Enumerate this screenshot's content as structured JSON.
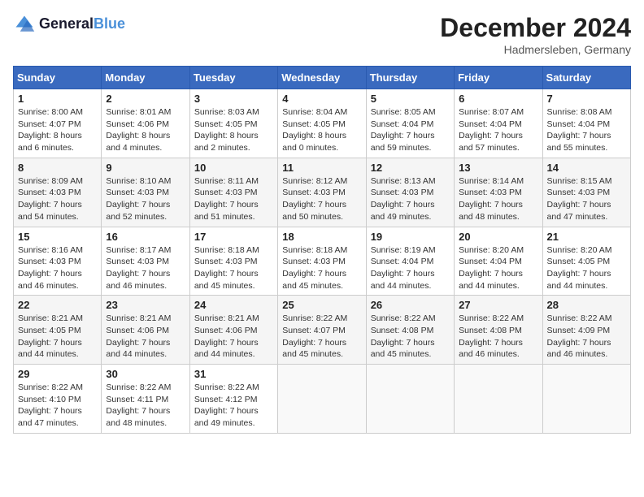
{
  "header": {
    "logo_line1": "General",
    "logo_line2": "Blue",
    "month_title": "December 2024",
    "location": "Hadmersleben, Germany"
  },
  "weekdays": [
    "Sunday",
    "Monday",
    "Tuesday",
    "Wednesday",
    "Thursday",
    "Friday",
    "Saturday"
  ],
  "weeks": [
    [
      {
        "day": "1",
        "sunrise": "8:00 AM",
        "sunset": "4:07 PM",
        "daylight": "8 hours and 6 minutes."
      },
      {
        "day": "2",
        "sunrise": "8:01 AM",
        "sunset": "4:06 PM",
        "daylight": "8 hours and 4 minutes."
      },
      {
        "day": "3",
        "sunrise": "8:03 AM",
        "sunset": "4:05 PM",
        "daylight": "8 hours and 2 minutes."
      },
      {
        "day": "4",
        "sunrise": "8:04 AM",
        "sunset": "4:05 PM",
        "daylight": "8 hours and 0 minutes."
      },
      {
        "day": "5",
        "sunrise": "8:05 AM",
        "sunset": "4:04 PM",
        "daylight": "7 hours and 59 minutes."
      },
      {
        "day": "6",
        "sunrise": "8:07 AM",
        "sunset": "4:04 PM",
        "daylight": "7 hours and 57 minutes."
      },
      {
        "day": "7",
        "sunrise": "8:08 AM",
        "sunset": "4:04 PM",
        "daylight": "7 hours and 55 minutes."
      }
    ],
    [
      {
        "day": "8",
        "sunrise": "8:09 AM",
        "sunset": "4:03 PM",
        "daylight": "7 hours and 54 minutes."
      },
      {
        "day": "9",
        "sunrise": "8:10 AM",
        "sunset": "4:03 PM",
        "daylight": "7 hours and 52 minutes."
      },
      {
        "day": "10",
        "sunrise": "8:11 AM",
        "sunset": "4:03 PM",
        "daylight": "7 hours and 51 minutes."
      },
      {
        "day": "11",
        "sunrise": "8:12 AM",
        "sunset": "4:03 PM",
        "daylight": "7 hours and 50 minutes."
      },
      {
        "day": "12",
        "sunrise": "8:13 AM",
        "sunset": "4:03 PM",
        "daylight": "7 hours and 49 minutes."
      },
      {
        "day": "13",
        "sunrise": "8:14 AM",
        "sunset": "4:03 PM",
        "daylight": "7 hours and 48 minutes."
      },
      {
        "day": "14",
        "sunrise": "8:15 AM",
        "sunset": "4:03 PM",
        "daylight": "7 hours and 47 minutes."
      }
    ],
    [
      {
        "day": "15",
        "sunrise": "8:16 AM",
        "sunset": "4:03 PM",
        "daylight": "7 hours and 46 minutes."
      },
      {
        "day": "16",
        "sunrise": "8:17 AM",
        "sunset": "4:03 PM",
        "daylight": "7 hours and 46 minutes."
      },
      {
        "day": "17",
        "sunrise": "8:18 AM",
        "sunset": "4:03 PM",
        "daylight": "7 hours and 45 minutes."
      },
      {
        "day": "18",
        "sunrise": "8:18 AM",
        "sunset": "4:03 PM",
        "daylight": "7 hours and 45 minutes."
      },
      {
        "day": "19",
        "sunrise": "8:19 AM",
        "sunset": "4:04 PM",
        "daylight": "7 hours and 44 minutes."
      },
      {
        "day": "20",
        "sunrise": "8:20 AM",
        "sunset": "4:04 PM",
        "daylight": "7 hours and 44 minutes."
      },
      {
        "day": "21",
        "sunrise": "8:20 AM",
        "sunset": "4:05 PM",
        "daylight": "7 hours and 44 minutes."
      }
    ],
    [
      {
        "day": "22",
        "sunrise": "8:21 AM",
        "sunset": "4:05 PM",
        "daylight": "7 hours and 44 minutes."
      },
      {
        "day": "23",
        "sunrise": "8:21 AM",
        "sunset": "4:06 PM",
        "daylight": "7 hours and 44 minutes."
      },
      {
        "day": "24",
        "sunrise": "8:21 AM",
        "sunset": "4:06 PM",
        "daylight": "7 hours and 44 minutes."
      },
      {
        "day": "25",
        "sunrise": "8:22 AM",
        "sunset": "4:07 PM",
        "daylight": "7 hours and 45 minutes."
      },
      {
        "day": "26",
        "sunrise": "8:22 AM",
        "sunset": "4:08 PM",
        "daylight": "7 hours and 45 minutes."
      },
      {
        "day": "27",
        "sunrise": "8:22 AM",
        "sunset": "4:08 PM",
        "daylight": "7 hours and 46 minutes."
      },
      {
        "day": "28",
        "sunrise": "8:22 AM",
        "sunset": "4:09 PM",
        "daylight": "7 hours and 46 minutes."
      }
    ],
    [
      {
        "day": "29",
        "sunrise": "8:22 AM",
        "sunset": "4:10 PM",
        "daylight": "7 hours and 47 minutes."
      },
      {
        "day": "30",
        "sunrise": "8:22 AM",
        "sunset": "4:11 PM",
        "daylight": "7 hours and 48 minutes."
      },
      {
        "day": "31",
        "sunrise": "8:22 AM",
        "sunset": "4:12 PM",
        "daylight": "7 hours and 49 minutes."
      },
      null,
      null,
      null,
      null
    ]
  ]
}
